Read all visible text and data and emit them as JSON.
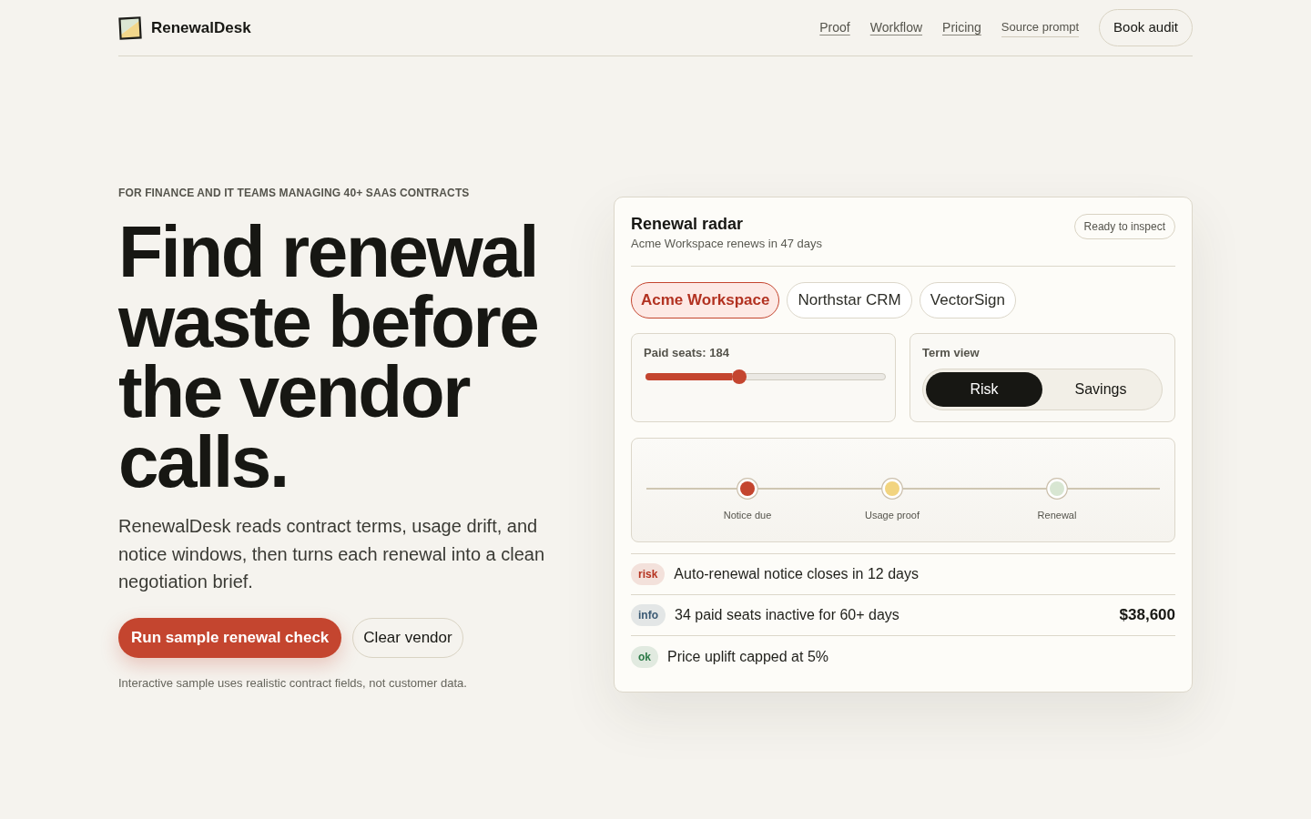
{
  "header": {
    "brand": "RenewalDesk",
    "nav_links": [
      "Proof",
      "Workflow",
      "Pricing"
    ],
    "source_link": "Source prompt",
    "cta": "Book audit"
  },
  "hero": {
    "eyebrow": "FOR FINANCE AND IT TEAMS MANAGING 40+ SAAS CONTRACTS",
    "headline": "Find renewal waste before the vendor calls.",
    "description": "RenewalDesk reads contract terms, usage drift, and notice windows, then turns each renewal into a clean negotiation brief.",
    "primary_button": "Run sample renewal check",
    "secondary_button": "Clear vendor",
    "footnote": "Interactive sample uses realistic contract fields, not customer data."
  },
  "radar": {
    "title": "Renewal radar",
    "subtitle": "Acme Workspace renews in 47 days",
    "status_badge": "Ready to inspect",
    "vendor_tabs": [
      {
        "label": "Acme Workspace",
        "selected": true
      },
      {
        "label": "Northstar CRM",
        "selected": false
      },
      {
        "label": "VectorSign",
        "selected": false
      }
    ],
    "seats": {
      "label": "Paid seats: 184",
      "level": 0.39
    },
    "term_view": {
      "label": "Term view",
      "options": [
        {
          "label": "Risk",
          "selected": true
        },
        {
          "label": "Savings",
          "selected": false
        }
      ]
    },
    "milestones": [
      {
        "label": "Notice due",
        "color": "#c4452f"
      },
      {
        "label": "Usage proof",
        "color": "#f2d47f"
      },
      {
        "label": "Renewal",
        "color": "#d8e6d2"
      }
    ],
    "findings": [
      {
        "tag": "risk",
        "color": "#b5321f",
        "text": "Auto-renewal notice closes in 12 days"
      },
      {
        "tag": "info",
        "color": "#3b5a74",
        "text": "34 paid seats inactive for 60+ days",
        "amount": "$38,600"
      },
      {
        "tag": "ok",
        "color": "#2c7a47",
        "text": "Price uplift capped at 5%"
      }
    ]
  }
}
